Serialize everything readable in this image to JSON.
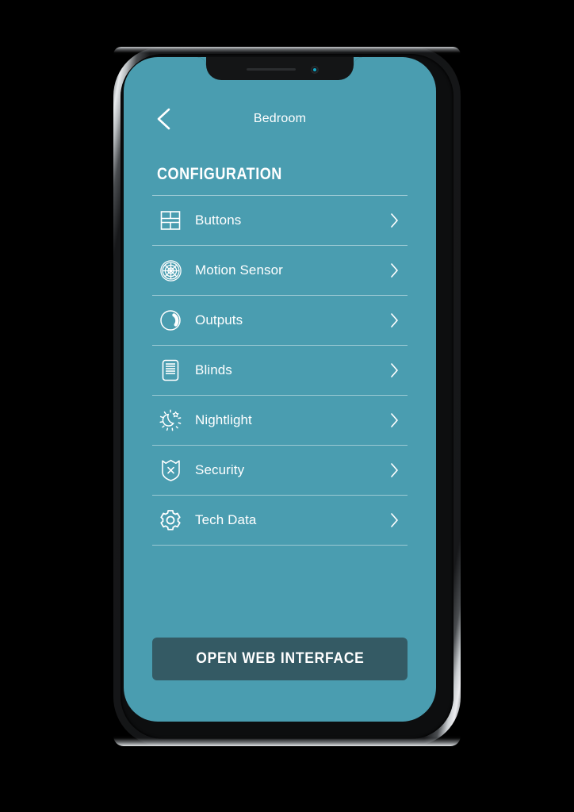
{
  "colors": {
    "page_background": "#000000",
    "screen_background": "#4a9db0",
    "accent_text": "#ffffff",
    "cta_background": "#345a64",
    "divider": "rgba(255,255,255,0.45)",
    "camera_iris": "#13a6c4"
  },
  "device": {
    "notch": {
      "speaker_name": "earpiece-speaker",
      "camera_name": "front-camera"
    }
  },
  "navbar": {
    "back_icon": "chevron-left-icon",
    "title": "Bedroom"
  },
  "section": {
    "title": "CONFIGURATION"
  },
  "list": {
    "items": [
      {
        "label": "Buttons",
        "icon": "buttons-grid-icon",
        "chevron": "chevron-right-icon"
      },
      {
        "label": "Motion Sensor",
        "icon": "motion-sensor-icon",
        "chevron": "chevron-right-icon"
      },
      {
        "label": "Outputs",
        "icon": "outputs-dial-icon",
        "chevron": "chevron-right-icon"
      },
      {
        "label": "Blinds",
        "icon": "blinds-icon",
        "chevron": "chevron-right-icon"
      },
      {
        "label": "Nightlight",
        "icon": "nightlight-icon",
        "chevron": "chevron-right-icon"
      },
      {
        "label": "Security",
        "icon": "security-shield-icon",
        "chevron": "chevron-right-icon"
      },
      {
        "label": "Tech Data",
        "icon": "gear-icon",
        "chevron": "chevron-right-icon"
      }
    ]
  },
  "cta": {
    "label": "OPEN WEB INTERFACE"
  }
}
